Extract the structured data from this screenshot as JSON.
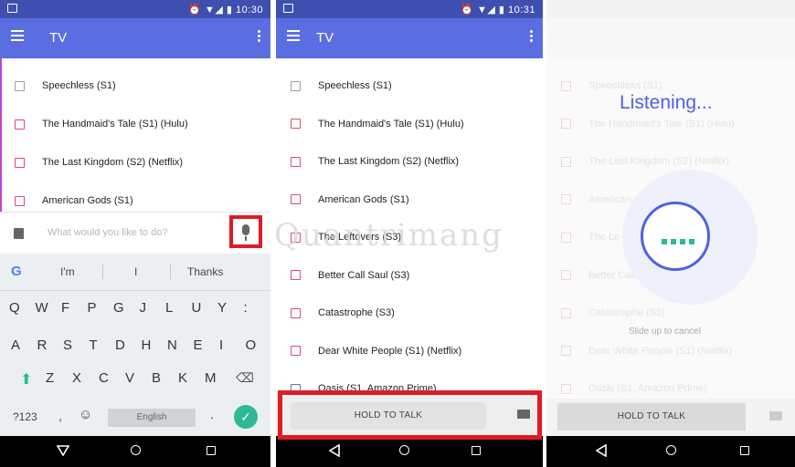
{
  "panel1": {
    "status_time": "10:30",
    "title": "TV",
    "items": [
      {
        "label": "Speechless (S1)",
        "color": "grey"
      },
      {
        "label": "The Handmaid's Tale (S1) (Hulu)",
        "color": "red"
      },
      {
        "label": "The Last Kingdom (S2) (Netflix)",
        "color": "red"
      },
      {
        "label": "American Gods (S1)",
        "color": "red"
      }
    ],
    "input_placeholder": "What would you like to do?",
    "keyboard": {
      "suggestions": [
        "I'm",
        "I",
        "Thanks"
      ],
      "row1": [
        "Q",
        "W",
        "F",
        "P",
        "G",
        "J",
        "L",
        "U",
        "Y",
        ":"
      ],
      "row2": [
        "A",
        "R",
        "S",
        "T",
        "D",
        "H",
        "N",
        "E",
        "I",
        "O"
      ],
      "row3": [
        "Z",
        "X",
        "C",
        "V",
        "B",
        "K",
        "M"
      ],
      "symbols_key": "?123",
      "comma_key": ",",
      "space_label": "English",
      "period_key": "."
    }
  },
  "panel2": {
    "status_time": "10:31",
    "title": "TV",
    "items": [
      {
        "label": "Speechless (S1)",
        "color": "grey"
      },
      {
        "label": "The Handmaid's Tale (S1) (Hulu)",
        "color": "red"
      },
      {
        "label": "The Last Kingdom (S2) (Netflix)",
        "color": "red"
      },
      {
        "label": "American Gods (S1)",
        "color": "red"
      },
      {
        "label": "The Leftovers (S3)",
        "color": "red"
      },
      {
        "label": "Better Call Saul (S3)",
        "color": "red"
      },
      {
        "label": "Catastrophe (S3)",
        "color": "red"
      },
      {
        "label": "Dear White People (S1) (Netflix)",
        "color": "red"
      },
      {
        "label": "Oasis (S1, Amazon Prime)",
        "color": "blue"
      }
    ],
    "talk_button": "HOLD TO TALK"
  },
  "panel3": {
    "listening": "Listening...",
    "slide_cancel": "Slide up to cancel",
    "faded_items": [
      "Speechless (S1)",
      "The Handmaid's Tale (S1) (Hulu)",
      "The Last Kingdom (S2) (Netflix)",
      "American Go",
      "The Le",
      "Better Call Saul (S3)",
      "Catastrophe (S3)",
      "Dear White People (S1) (Netflix)",
      "Oasis (S1, Amazon Prime)"
    ],
    "talk_button": "HOLD TO TALK"
  },
  "watermark": "Quantrimang",
  "colors": {
    "appbar": "#5b6ee1",
    "statusbar": "#3f4fb0",
    "highlight": "#e01b24",
    "accent_green": "#2db896"
  }
}
